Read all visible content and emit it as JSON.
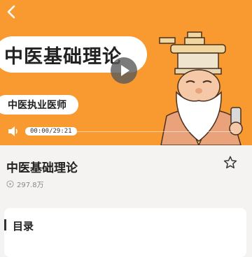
{
  "player": {
    "banner_title": "中医基础理论",
    "banner_subtitle": "中医执业医师",
    "time_display": "00:00/29:21",
    "progress_fraction": 0
  },
  "course": {
    "title": "中医基础理论",
    "play_count": "297.8万"
  },
  "catalog": {
    "title": "目录"
  },
  "colors": {
    "hero_bg": "#f89a2f",
    "page_bg": "#f4f3f1"
  },
  "icons": [
    "back-arrow-icon",
    "play-icon",
    "volume-icon",
    "star-icon",
    "play-count-icon"
  ]
}
